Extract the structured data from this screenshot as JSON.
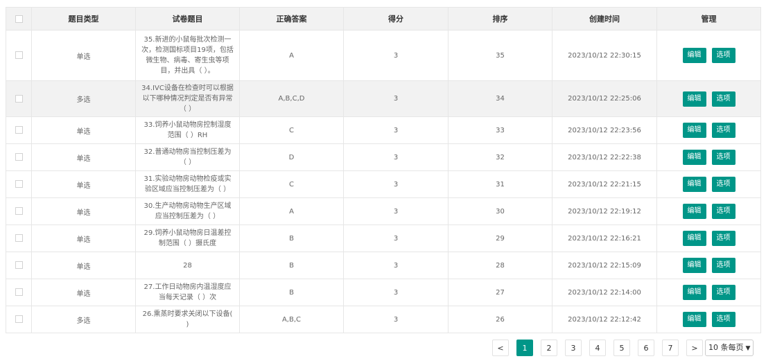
{
  "table": {
    "headers": [
      "题目类型",
      "试卷题目",
      "正确答案",
      "得分",
      "排序",
      "创建时间",
      "管理"
    ],
    "edit_label": "编辑",
    "options_label": "选项",
    "rows": [
      {
        "type": "单选",
        "question": "35.新进的小鼠每批次检测一次，检测国标项目19项，包括微生物、病毒、寄生虫等项目，并出具（ ）。",
        "answer": "A",
        "score": "3",
        "order": "35",
        "created": "2023/10/12 22:30:15"
      },
      {
        "type": "多选",
        "question": "34.IVC设备在检查时可以根据以下哪种情况判定是否有异常（ ）",
        "answer": "A,B,C,D",
        "score": "3",
        "order": "34",
        "created": "2023/10/12 22:25:06"
      },
      {
        "type": "单选",
        "question": "33.饲养小鼠动物房控制湿度范围（ ）RH",
        "answer": "C",
        "score": "3",
        "order": "33",
        "created": "2023/10/12 22:23:56"
      },
      {
        "type": "单选",
        "question": "32.普通动物房当控制压差为（ ）",
        "answer": "D",
        "score": "3",
        "order": "32",
        "created": "2023/10/12 22:22:38"
      },
      {
        "type": "单选",
        "question": "31.实验动物房动物检疫或实验区域应当控制压差为（ ）",
        "answer": "C",
        "score": "3",
        "order": "31",
        "created": "2023/10/12 22:21:15"
      },
      {
        "type": "单选",
        "question": "30.生产动物房动物生产区域应当控制压差为（ ）",
        "answer": "A",
        "score": "3",
        "order": "30",
        "created": "2023/10/12 22:19:12"
      },
      {
        "type": "单选",
        "question": "29.饲养小鼠动物房日温差控制范围（ ）摄氏度",
        "answer": "B",
        "score": "3",
        "order": "29",
        "created": "2023/10/12 22:16:21"
      },
      {
        "type": "单选",
        "question": "28",
        "answer": "B",
        "score": "3",
        "order": "28",
        "created": "2023/10/12 22:15:09"
      },
      {
        "type": "单选",
        "question": "27.工作日动物房内温湿度应当每天记录（ ）次",
        "answer": "B",
        "score": "3",
        "order": "27",
        "created": "2023/10/12 22:14:00"
      },
      {
        "type": "多选",
        "question": "26.熏蒸时要求关闭以下设备( )",
        "answer": "A,B,C",
        "score": "3",
        "order": "26",
        "created": "2023/10/12 22:12:42"
      }
    ]
  },
  "pagination": {
    "prev": "<",
    "next": ">",
    "pages": [
      "1",
      "2",
      "3",
      "4",
      "5",
      "6",
      "7"
    ],
    "current": "1",
    "page_size_selected": "10 条每页"
  },
  "colors": {
    "accent": "#009688",
    "header_bg": "#f2f2f2",
    "border": "#e6e6e6"
  }
}
